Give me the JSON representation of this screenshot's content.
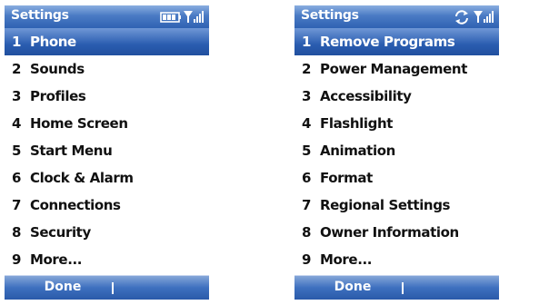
{
  "screens": [
    {
      "title": "Settings",
      "status_icons": [
        "battery-icon",
        "signal-icon"
      ],
      "items": [
        {
          "num": "1",
          "label": "Phone",
          "selected": true
        },
        {
          "num": "2",
          "label": "Sounds",
          "selected": false
        },
        {
          "num": "3",
          "label": "Profiles",
          "selected": false
        },
        {
          "num": "4",
          "label": "Home Screen",
          "selected": false
        },
        {
          "num": "5",
          "label": "Start Menu",
          "selected": false
        },
        {
          "num": "6",
          "label": "Clock & Alarm",
          "selected": false
        },
        {
          "num": "7",
          "label": "Connections",
          "selected": false
        },
        {
          "num": "8",
          "label": "Security",
          "selected": false
        },
        {
          "num": "9",
          "label": "More...",
          "selected": false
        }
      ],
      "softkey_left": "Done"
    },
    {
      "title": "Settings",
      "status_icons": [
        "sync-icon",
        "signal-icon"
      ],
      "items": [
        {
          "num": "1",
          "label": "Remove Programs",
          "selected": true
        },
        {
          "num": "2",
          "label": "Power Management",
          "selected": false
        },
        {
          "num": "3",
          "label": "Accessibility",
          "selected": false
        },
        {
          "num": "4",
          "label": "Flashlight",
          "selected": false
        },
        {
          "num": "5",
          "label": "Animation",
          "selected": false
        },
        {
          "num": "6",
          "label": "Format",
          "selected": false
        },
        {
          "num": "7",
          "label": "Regional Settings",
          "selected": false
        },
        {
          "num": "8",
          "label": "Owner Information",
          "selected": false
        },
        {
          "num": "9",
          "label": "More...",
          "selected": false
        }
      ],
      "softkey_left": "Done"
    }
  ],
  "colors": {
    "titlebar": "#4a7bc4",
    "selection": "#2a5db0",
    "text": "#111111",
    "highlight_text": "#ffffff"
  }
}
